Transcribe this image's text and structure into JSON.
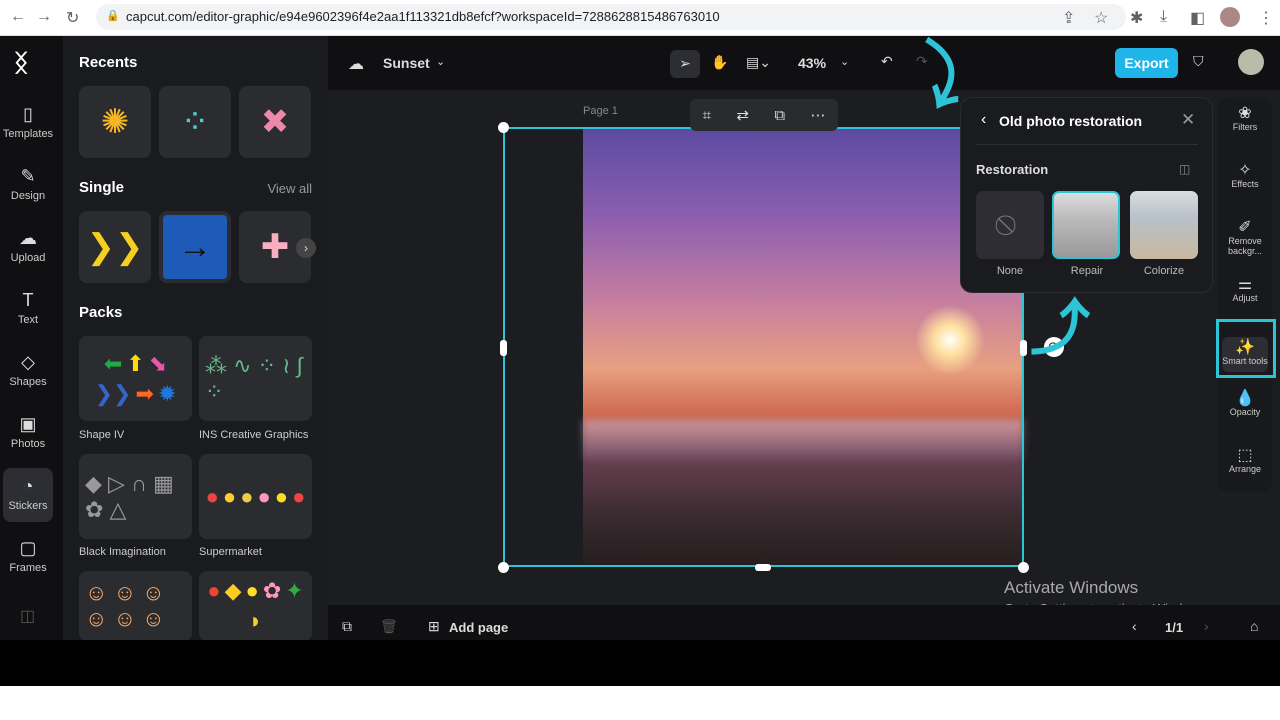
{
  "browser": {
    "url": "capcut.com/editor-graphic/e94e9602396f4e2aa1f113321db8efcf?workspaceId=7288628815486763010"
  },
  "nav": [
    {
      "label": "Templates",
      "icon": "templates-icon",
      "glyph": "▯"
    },
    {
      "label": "Design",
      "icon": "design-icon",
      "glyph": "✎"
    },
    {
      "label": "Upload",
      "icon": "upload-icon",
      "glyph": "☁"
    },
    {
      "label": "Text",
      "icon": "text-icon",
      "glyph": "T"
    },
    {
      "label": "Shapes",
      "icon": "shapes-icon",
      "glyph": "◇"
    },
    {
      "label": "Photos",
      "icon": "photos-icon",
      "glyph": "▣"
    },
    {
      "label": "Stickers",
      "icon": "stickers-icon",
      "glyph": "◔"
    },
    {
      "label": "Frames",
      "icon": "frames-icon",
      "glyph": "▢"
    }
  ],
  "panel": {
    "recents": "Recents",
    "single": "Single",
    "view_all": "View all",
    "packs": "Packs",
    "pack_names": [
      "Shape IV",
      "INS Creative Graphics",
      "Black Imagination",
      "Supermarket"
    ]
  },
  "topbar": {
    "project": "Sunset",
    "zoom": "43%",
    "export": "Export"
  },
  "canvas": {
    "page_label": "Page 1"
  },
  "popup": {
    "title": "Old photo restoration",
    "section": "Restoration",
    "options": [
      "None",
      "Repair",
      "Colorize"
    ],
    "selected": "Repair"
  },
  "right_panel": [
    {
      "label": "Filters",
      "glyph": "❀"
    },
    {
      "label": "Effects",
      "glyph": "✧"
    },
    {
      "label": "Remove backgr...",
      "glyph": "✐"
    },
    {
      "label": "Adjust",
      "glyph": "⚌"
    },
    {
      "label": "Smart tools",
      "glyph": "✨"
    },
    {
      "label": "Opacity",
      "glyph": "💧"
    },
    {
      "label": "Arrange",
      "glyph": "⬚"
    }
  ],
  "bottom": {
    "add_page": "Add page",
    "page_count": "1/1"
  },
  "watermark": {
    "title": "Activate Windows",
    "subtitle": "Go to Settings to activate Windows."
  },
  "colors": {
    "accent": "#2ec4d8",
    "export": "#1fb5e8"
  }
}
